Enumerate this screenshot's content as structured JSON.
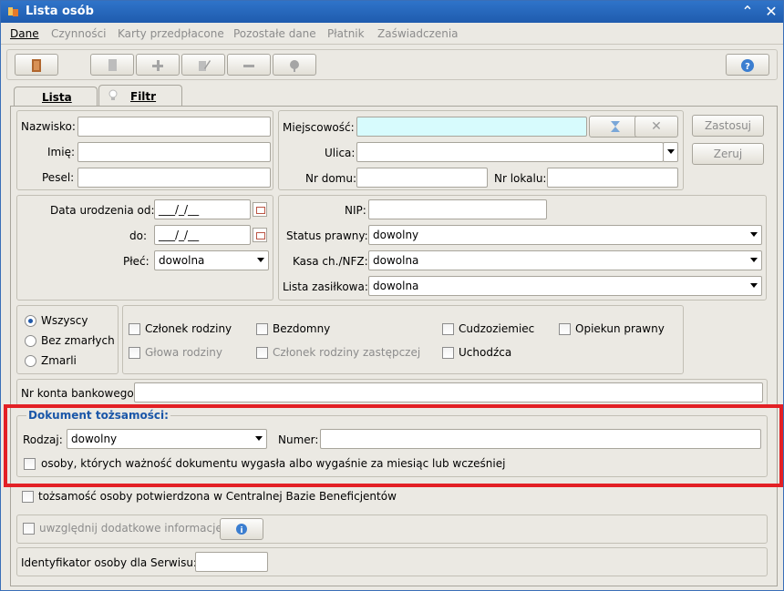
{
  "window": {
    "title": "Lista osób"
  },
  "menu": {
    "items": [
      "Dane",
      "Czynności",
      "Karty przedpłacone",
      "Pozostałe dane",
      "Płatnik",
      "Zaświadczenia"
    ]
  },
  "tabs": {
    "lista": "Lista",
    "filtr": "Filtr"
  },
  "person": {
    "nazwisko_label": "Nazwisko:",
    "nazwisko_value": "",
    "imie_label": "Imię:",
    "imie_value": "",
    "pesel_label": "Pesel:",
    "pesel_value": ""
  },
  "address": {
    "miejscowosc_label": "Miejscowość:",
    "miejscowosc_value": "",
    "ulica_label": "Ulica:",
    "ulica_value": "",
    "nr_domu_label": "Nr domu:",
    "nr_domu_value": "",
    "nr_lokalu_label": "Nr lokalu:",
    "nr_lokalu_value": ""
  },
  "actions": {
    "zastosuj": "Zastosuj",
    "zeruj": "Zeruj"
  },
  "birth": {
    "od_label": "Data urodzenia od:",
    "od_value": "___/_/__",
    "do_label": "do:",
    "do_value": "___/_/__",
    "plec_label": "Płeć:",
    "plec_value": "dowolna"
  },
  "legal": {
    "nip_label": "NIP:",
    "nip_value": "",
    "status_label": "Status prawny:",
    "status_value": "dowolny",
    "kasa_label": "Kasa ch./NFZ:",
    "kasa_value": "dowolna",
    "lista_label": "Lista zasiłkowa:",
    "lista_value": "dowolna"
  },
  "radio": {
    "options": [
      "Wszyscy",
      "Bez zmarłych",
      "Zmarli"
    ],
    "selected": "Wszyscy"
  },
  "flags": {
    "czlonek": "Członek rodziny",
    "glowa": "Głowa rodziny",
    "bezdomny": "Bezdomny",
    "zastepczej": "Członek rodziny zastępczej",
    "cudzoziemiec": "Cudzoziemiec",
    "uchodzca": "Uchodźca",
    "opiekun": "Opiekun prawny"
  },
  "bank": {
    "label": "Nr konta bankowego:",
    "value": ""
  },
  "document": {
    "legend": "Dokument tożsamości:",
    "rodzaj_label": "Rodzaj:",
    "rodzaj_value": "dowolny",
    "numer_label": "Numer:",
    "numer_value": "",
    "expired_label": "osoby, których ważność dokumentu wygasła albo wygaśnie za miesiąc lub wcześniej"
  },
  "cbb": {
    "label": "tożsamość osoby potwierdzona w Centralnej Bazie Beneficjentów"
  },
  "extra": {
    "label": "uwzględnij dodatkowe informacje"
  },
  "service": {
    "label": "Identyfikator osoby dla Serwisu:",
    "value": ""
  },
  "colors": {
    "title_bar": "#2f74c9",
    "highlight": "#e32025",
    "accent_text": "#1a56a8",
    "cyan_field": "#d7fbfd"
  }
}
